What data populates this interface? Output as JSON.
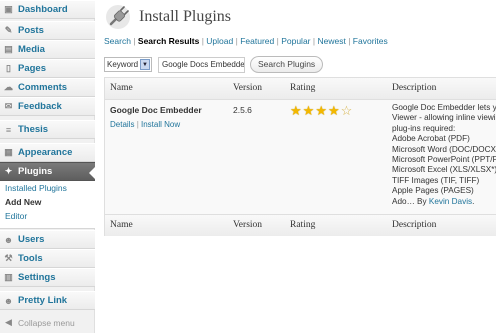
{
  "sidebar": {
    "items": [
      {
        "name": "dashboard",
        "label": "Dashboard",
        "icon": "dashboard-icon",
        "glyph": "▣"
      },
      {
        "name": "posts",
        "label": "Posts",
        "icon": "pushpin-icon",
        "glyph": "✎"
      },
      {
        "name": "media",
        "label": "Media",
        "icon": "media-icon",
        "glyph": "▤"
      },
      {
        "name": "pages",
        "label": "Pages",
        "icon": "pages-icon",
        "glyph": "▯"
      },
      {
        "name": "comments",
        "label": "Comments",
        "icon": "comments-icon",
        "glyph": "☁"
      },
      {
        "name": "feedback",
        "label": "Feedback",
        "icon": "feedback-icon",
        "glyph": "✉"
      },
      {
        "name": "thesis",
        "label": "Thesis",
        "icon": "thesis-icon",
        "glyph": "≡"
      },
      {
        "name": "appearance",
        "label": "Appearance",
        "icon": "appearance-icon",
        "glyph": "▦"
      },
      {
        "name": "plugins",
        "label": "Plugins",
        "icon": "plugin-icon",
        "glyph": "✦"
      },
      {
        "name": "users",
        "label": "Users",
        "icon": "users-icon",
        "glyph": "☻"
      },
      {
        "name": "tools",
        "label": "Tools",
        "icon": "tools-icon",
        "glyph": "⚒"
      },
      {
        "name": "settings",
        "label": "Settings",
        "icon": "settings-icon",
        "glyph": "▥"
      },
      {
        "name": "pretty-link",
        "label": "Pretty Link",
        "icon": "pretty-link-icon",
        "glyph": "☻"
      },
      {
        "name": "collapse-menu",
        "label": "Collapse menu",
        "icon": "collapse-icon",
        "glyph": "◀"
      }
    ],
    "submenu": [
      "Installed Plugins",
      "Add New",
      "Editor"
    ]
  },
  "header": {
    "title": "Install Plugins",
    "icon": "plugin-plug-icon"
  },
  "tabs": {
    "items": [
      "Search",
      "Search Results",
      "Upload",
      "Featured",
      "Popular",
      "Newest",
      "Favorites"
    ],
    "current": "Search Results",
    "separator": "|"
  },
  "search": {
    "type_value": "Keyword",
    "term_value": "Google Docs Embedder",
    "button_label": "Search Plugins"
  },
  "table": {
    "columns": [
      "Name",
      "Version",
      "Rating",
      "Description"
    ],
    "rows": [
      {
        "name": "Google Doc Embedder",
        "action_details": "Details",
        "action_separator": "|",
        "action_install": "Install Now",
        "version": "2.5.6",
        "rating_stars": 4,
        "rating_max": 5,
        "description_lines": [
          "Google Doc Embedder lets you",
          "Viewer - allowing inline viewin",
          "plug-ins required:",
          "Adobe Acrobat (PDF)",
          "Microsoft Word (DOC/DOCX*)",
          "Microsoft PowerPoint (PPT/PP",
          "Microsoft Excel (XLS/XLSX*)",
          "TIFF Images (TIF, TIFF)",
          "Apple Pages (PAGES)"
        ],
        "description_by_prefix": "Ado… By",
        "description_author": "Kevin Davis",
        "description_suffix": "."
      }
    ]
  }
}
